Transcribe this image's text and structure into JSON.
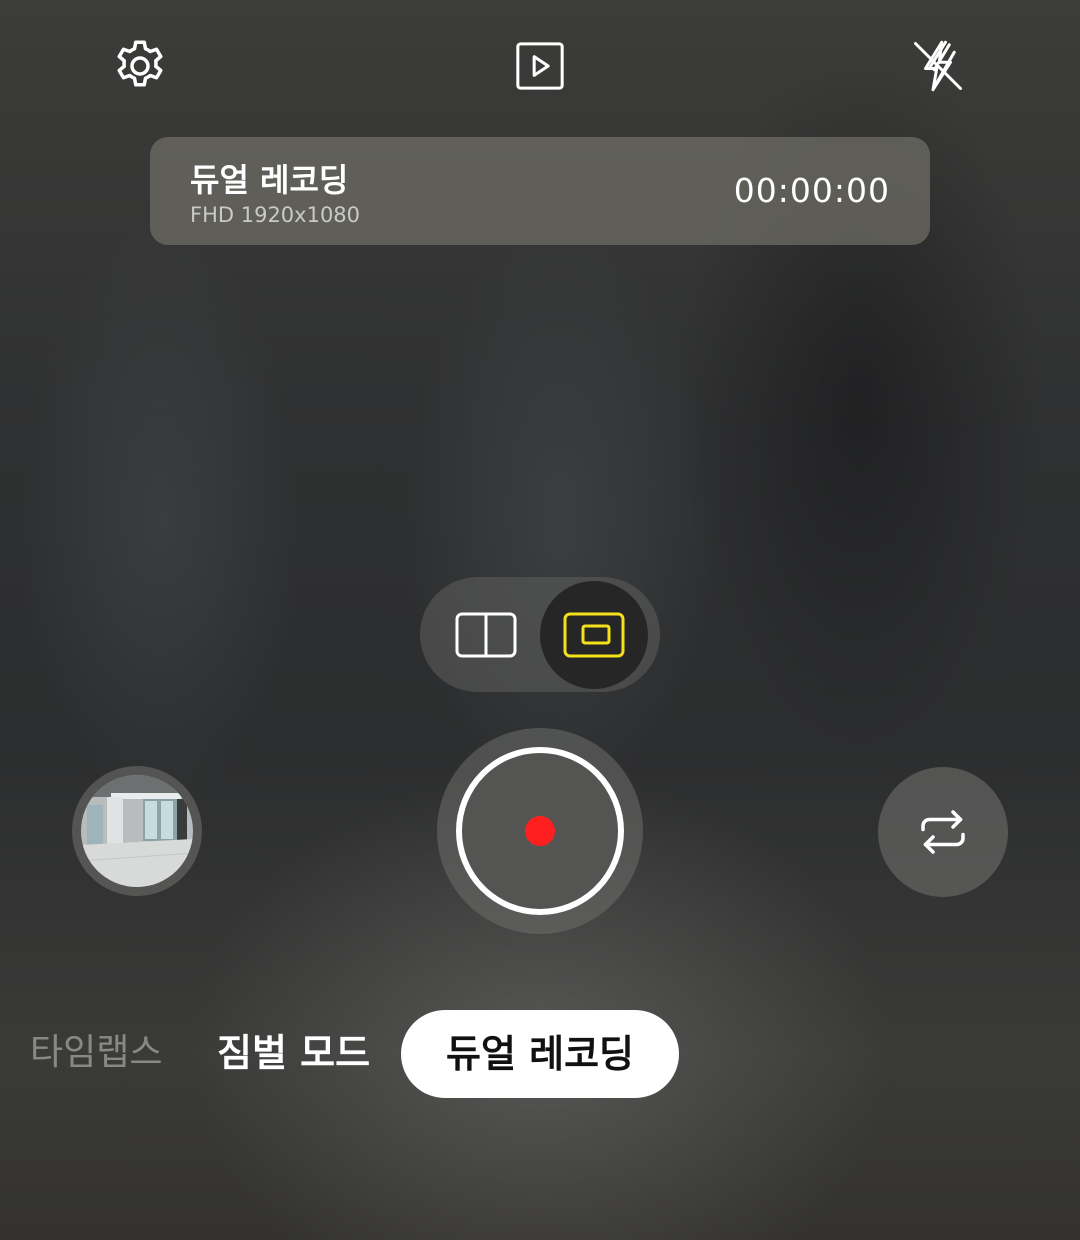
{
  "top_bar": {
    "settings_icon": "gear-icon",
    "gallery_icon": "play-square-icon",
    "flash_icon": "flash-off-icon"
  },
  "banner": {
    "title": "듀얼 레코딩",
    "resolution": "FHD 1920x1080",
    "timer": "00:00:00"
  },
  "layout_toggle": {
    "options": [
      "split-view-icon",
      "picture-in-picture-icon"
    ],
    "selected": "picture-in-picture-icon",
    "accent": "#f5e01c"
  },
  "shutter": {
    "record_dot_color": "#ff1f1f"
  },
  "modes": {
    "items": [
      "타임랩스",
      "짐벌 모드",
      "듀얼 레코딩"
    ],
    "active": "듀얼 레코딩"
  }
}
